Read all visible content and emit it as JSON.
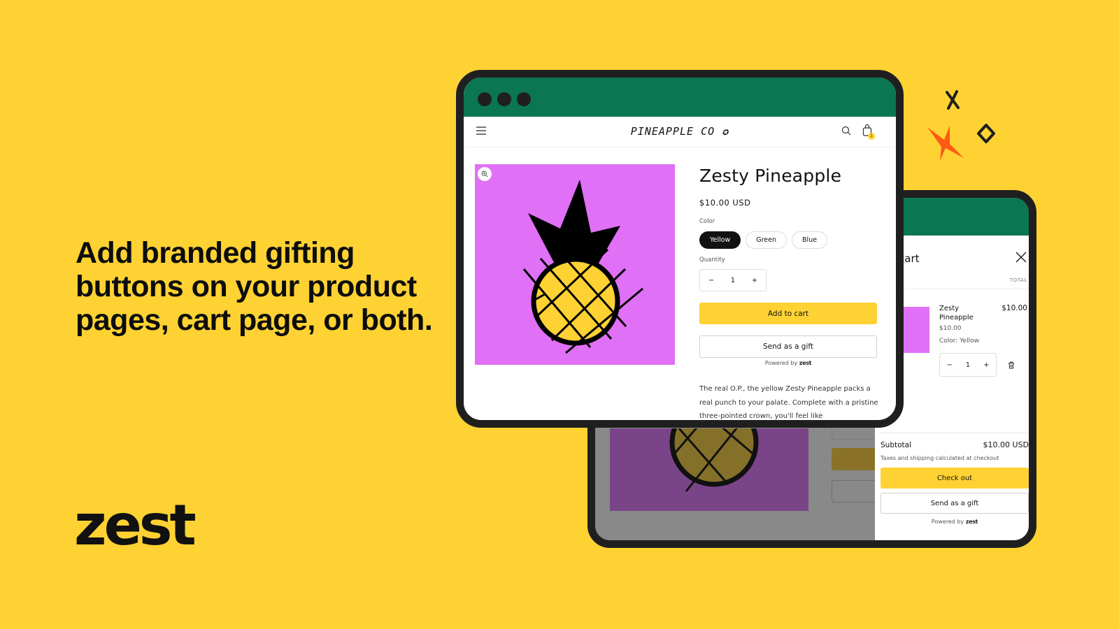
{
  "hero": {
    "headline_lines": [
      "Add branded gifting",
      "buttons on your product",
      "pages, cart page, or both."
    ],
    "brand": "zest"
  },
  "colors": {
    "background": "#FFD233",
    "browser_bar": "#0B7652",
    "product_bg": "#E070F5",
    "accent_button": "#FFD233",
    "star": "#FF5A14"
  },
  "product_page": {
    "store_name": "PINEAPPLE CO",
    "cart_count": "1",
    "title": "Zesty Pineapple",
    "price": "$10.00 USD",
    "color_label": "Color",
    "colors": [
      {
        "label": "Yellow",
        "selected": true
      },
      {
        "label": "Green",
        "selected": false
      },
      {
        "label": "Blue",
        "selected": false
      }
    ],
    "quantity_label": "Quantity",
    "quantity": "1",
    "minus": "−",
    "plus": "+",
    "add_to_cart": "Add to cart",
    "send_gift": "Send as a gift",
    "powered_by": "Powered by",
    "powered_brand": "zest",
    "description": "The real O.P., the yellow Zesty Pineapple packs a real punch to your palate. Complete with a pristine three-pointed crown, you'll feel like"
  },
  "cart_drawer": {
    "title": "cart",
    "total_header": "TOTAL",
    "item": {
      "name": "Zesty Pineapple",
      "line_total": "$10.00",
      "unit_price": "$10.00",
      "variant": "Color: Yellow",
      "quantity": "1"
    },
    "subtotal_label": "Subtotal",
    "subtotal_value": "$10.00 USD",
    "tax_note": "Taxes and shipping calculated at checkout",
    "checkout": "Check out",
    "send_gift": "Send as a gift",
    "powered_by": "Powered by",
    "powered_brand": "zest"
  }
}
